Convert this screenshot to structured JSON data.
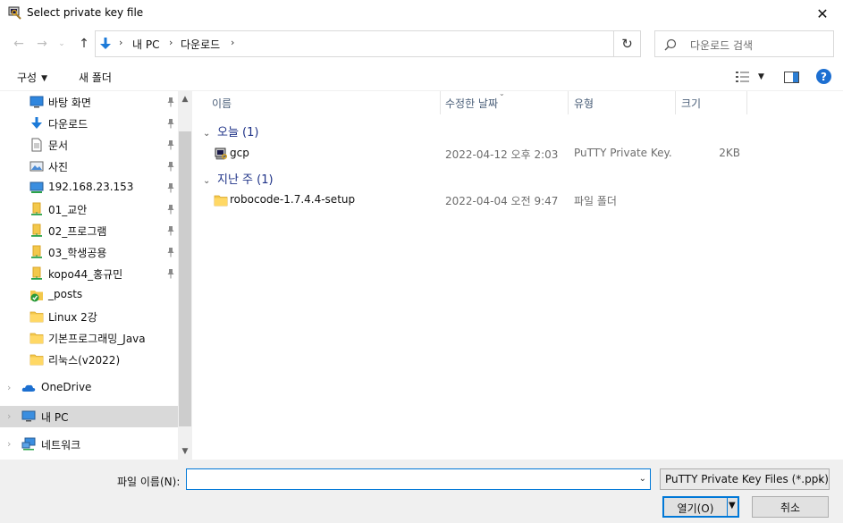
{
  "window": {
    "title": "Select private key file"
  },
  "address": {
    "crumbs": [
      "내 PC",
      "다운로드"
    ]
  },
  "search": {
    "placeholder": "다운로드 검색"
  },
  "commandbar": {
    "organize_label": "구성",
    "new_folder_label": "새 폴더"
  },
  "navpane": {
    "quick_access": [
      {
        "label": "바탕 화면",
        "icon": "desktop-icon",
        "pinned": true
      },
      {
        "label": "다운로드",
        "icon": "download-arrow-icon",
        "pinned": true
      },
      {
        "label": "문서",
        "icon": "document-icon",
        "pinned": true
      },
      {
        "label": "사진",
        "icon": "picture-icon",
        "pinned": true
      },
      {
        "label": "192.168.23.153",
        "icon": "network-drive-icon",
        "pinned": true
      },
      {
        "label": "01_교안",
        "icon": "shared-folder-icon",
        "pinned": true
      },
      {
        "label": "02_프로그램",
        "icon": "shared-folder-icon",
        "pinned": true
      },
      {
        "label": "03_학생공용",
        "icon": "shared-folder-icon",
        "pinned": true
      },
      {
        "label": "kopo44_홍규민",
        "icon": "shared-folder-icon",
        "pinned": true
      },
      {
        "label": "_posts",
        "icon": "synced-folder-icon",
        "pinned": false
      },
      {
        "label": "Linux 2강",
        "icon": "folder-icon",
        "pinned": false
      },
      {
        "label": "기본프로그래밍_Java",
        "icon": "folder-icon",
        "pinned": false
      },
      {
        "label": "리눅스(v2022)",
        "icon": "folder-icon",
        "pinned": false
      }
    ],
    "onedrive": "OneDrive",
    "this_pc": "내 PC",
    "network": "네트워크"
  },
  "filelist": {
    "columns": {
      "name": "이름",
      "modified": "수정한 날짜",
      "type": "유형",
      "size": "크기"
    },
    "groups": [
      {
        "header": "오늘 (1)",
        "files": [
          {
            "name": "gcp",
            "modified": "2022-04-12 오후 2:03",
            "type": "PuTTY Private Key...",
            "size": "2KB",
            "icon": "putty-key-icon"
          }
        ]
      },
      {
        "header": "지난 주 (1)",
        "files": [
          {
            "name": "robocode-1.7.4.4-setup",
            "modified": "2022-04-04 오전 9:47",
            "type": "파일 폴더",
            "size": "",
            "icon": "folder-icon"
          }
        ]
      }
    ]
  },
  "bottom": {
    "filename_label": "파일 이름(N):",
    "filename_value": "",
    "filter_value": "PuTTY Private Key Files (*.ppk)",
    "open_label": "열기(O)",
    "cancel_label": "취소"
  },
  "colors": {
    "accent": "#0078d7",
    "group_header": "#1e3287",
    "column_header": "#4c607a",
    "selected_nav": "#d9d9d9",
    "bottom_bg": "#f0f0f0"
  }
}
